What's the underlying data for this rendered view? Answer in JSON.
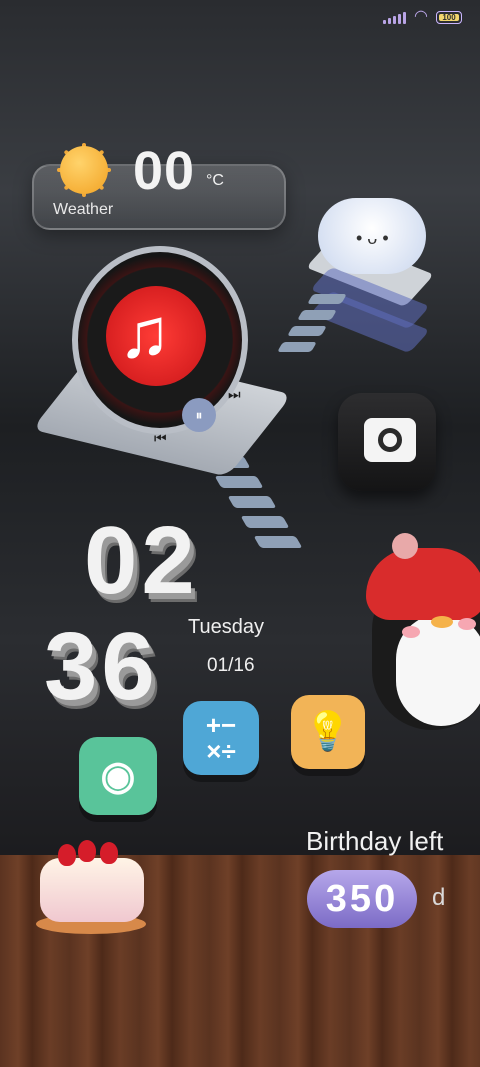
{
  "status_bar": {
    "battery": "100"
  },
  "weather": {
    "temperature": "00",
    "unit": "°C",
    "label": "Weather",
    "icon": "sun-icon"
  },
  "music": {
    "icon": "music-note-icon",
    "play": "⏸",
    "prev": "⏮",
    "next": "⏭"
  },
  "clock": {
    "hours": "02",
    "minutes": "36",
    "day": "Tuesday",
    "date": "01/16"
  },
  "apps": [
    {
      "name": "gallery",
      "icon": "palette-icon",
      "color": "#59c49a"
    },
    {
      "name": "calculator",
      "icon": "calculator-icon",
      "color": "#4fa7d6"
    },
    {
      "name": "tips",
      "icon": "lightbulb-icon",
      "color": "#f2b457"
    },
    {
      "name": "camera",
      "icon": "camera-icon",
      "color": "#1f1f21"
    }
  ],
  "birthday": {
    "label": "Birthday left",
    "days": "350",
    "unit": "d"
  }
}
